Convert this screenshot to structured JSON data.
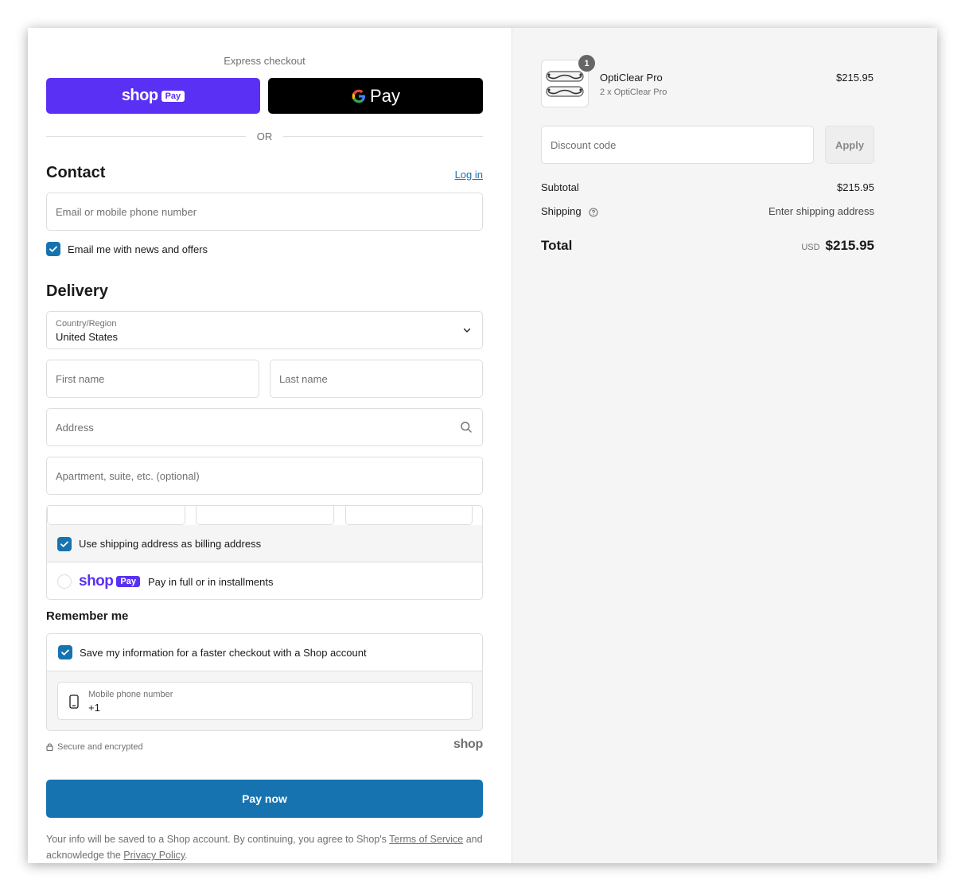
{
  "express": {
    "label": "Express checkout",
    "shop_pay_word": "shop",
    "shop_pay_badge": "Pay",
    "gpay_label": "Pay",
    "or_text": "OR"
  },
  "contact": {
    "title": "Contact",
    "login_label": "Log in",
    "email_placeholder": "Email or mobile phone number",
    "newsletter_label": "Email me with news and offers"
  },
  "delivery": {
    "title": "Delivery",
    "country_label": "Country/Region",
    "country_value": "United States",
    "first_name_placeholder": "First name",
    "last_name_placeholder": "Last name",
    "address_placeholder": "Address",
    "apartment_placeholder": "Apartment, suite, etc. (optional)",
    "billing_label": "Use shipping address as billing address",
    "shop_pay_word": "shop",
    "shop_pay_badge": "Pay",
    "shop_pay_desc": "Pay in full or in installments"
  },
  "remember": {
    "title": "Remember me",
    "save_label": "Save my information for a faster checkout with a Shop account",
    "phone_label": "Mobile phone number",
    "phone_value": "+1"
  },
  "footer": {
    "secure_label": "Secure and encrypted",
    "shop_brand": "shop",
    "pay_now_label": "Pay now",
    "legal_prefix": "Your info will be saved to a Shop account. By continuing, you agree to Shop's ",
    "terms_label": "Terms of Service",
    "legal_middle": " and acknowledge the ",
    "privacy_label": "Privacy Policy",
    "legal_suffix": "."
  },
  "summary": {
    "product_name": "OptiClear Pro",
    "product_sub": "2 x OptiClear Pro",
    "product_price": "$215.95",
    "quantity": "1",
    "discount_placeholder": "Discount code",
    "apply_label": "Apply",
    "subtotal_label": "Subtotal",
    "subtotal_value": "$215.95",
    "shipping_label": "Shipping",
    "shipping_value": "Enter shipping address",
    "total_label": "Total",
    "currency": "USD",
    "total_value": "$215.95"
  },
  "colors": {
    "shop_purple": "#5a31f4",
    "primary_blue": "#1773b0",
    "gpay_black": "#000000"
  }
}
